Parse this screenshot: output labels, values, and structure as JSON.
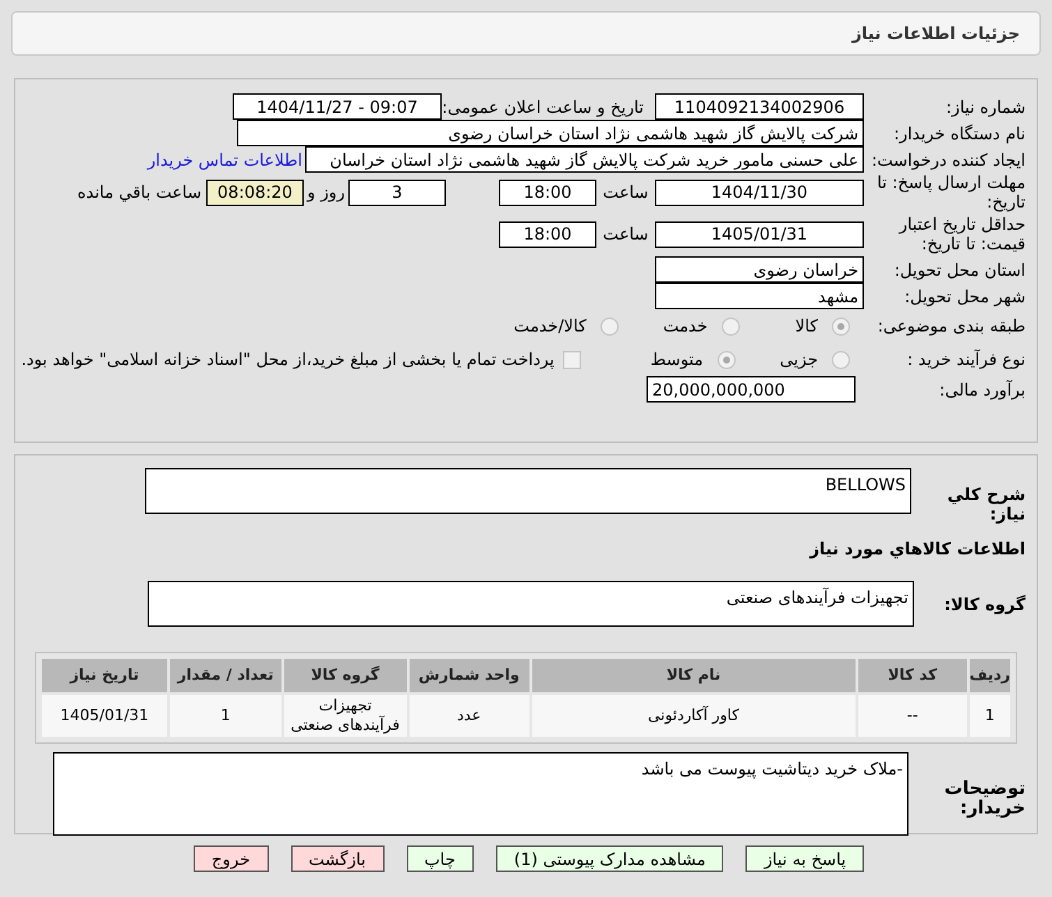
{
  "header": {
    "title": "جزئیات اطلاعات نیاز"
  },
  "need_number": {
    "label": "شماره نیاز:",
    "value": "1104092134002906"
  },
  "announce": {
    "label": "تاریخ و ساعت اعلان عمومی:",
    "value": "1404/11/27 - 09:07"
  },
  "buyer": {
    "label": "نام دستگاه خریدار:",
    "value": "شرکت پالایش گاز شهید هاشمی نژاد   استان خراسان رضوی"
  },
  "creator": {
    "label": "ایجاد کننده درخواست:",
    "value": "علی حسنی مامور خرید شرکت پالایش گاز شهید هاشمی نژاد   استان خراسان",
    "link": "اطلاعات تماس خریدار"
  },
  "deadline": {
    "label": "مهلت ارسال پاسخ: تا تاریخ:",
    "date": "1404/11/30",
    "time_label": "ساعت",
    "time": "18:00",
    "days": "3",
    "days_label": "روز و",
    "remaining": "08:08:20",
    "remaining_label": "ساعت باقي مانده"
  },
  "validity": {
    "label": "حداقل تاریخ اعتبار قیمت: تا تاریخ:",
    "date": "1405/01/31",
    "time_label": "ساعت",
    "time": "18:00"
  },
  "province": {
    "label": "استان محل تحویل:",
    "value": "خراسان رضوی"
  },
  "city": {
    "label": "شهر محل تحویل:",
    "value": "مشهد"
  },
  "category": {
    "label": "طبقه بندی موضوعی:",
    "options": [
      {
        "label": "كالا",
        "selected": true
      },
      {
        "label": "خدمت",
        "selected": false
      },
      {
        "label": "كالا/خدمت",
        "selected": false
      }
    ]
  },
  "process": {
    "label": "نوع فرآیند خرید :",
    "options": [
      {
        "label": "جزیی",
        "selected": false
      },
      {
        "label": "متوسط",
        "selected": true
      }
    ],
    "payment": {
      "checked": false,
      "label": "پرداخت تمام یا بخشی از مبلغ خرید،از محل \"اسناد خزانه اسلامی\" خواهد بود."
    }
  },
  "estimate": {
    "label": "برآورد مالی:",
    "value": "20,000,000,000"
  },
  "description": {
    "label": "شرح کلي نياز:",
    "value": "BELLOWS"
  },
  "goods_heading": "اطلاعات كالاهاي مورد نياز",
  "goods_group": {
    "label": "گروه کالا:",
    "value": "تجهیزات فرآیندهای صنعتی"
  },
  "table": {
    "columns": [
      "ردیف",
      "کد کالا",
      "نام کالا",
      "واحد شمارش",
      "گروه کالا",
      "تعداد / مقدار",
      "تاریخ نیاز"
    ],
    "rows": [
      [
        "1",
        "--",
        "کاور آکاردئونی",
        "عدد",
        "تجهیزات فرآیندهای صنعتی",
        "1",
        "1405/01/31"
      ]
    ]
  },
  "notes": {
    "label": "توضیحات خریدار:",
    "value": "-ملاک خرید دیتاشیت پیوست می باشد"
  },
  "buttons": [
    {
      "label": "پاسخ به نیاز",
      "kind": "normal"
    },
    {
      "label": "مشاهده مدارک پیوستی (1)",
      "kind": "normal"
    },
    {
      "label": "چاپ",
      "kind": "normal"
    },
    {
      "label": "بازگشت",
      "kind": "danger"
    },
    {
      "label": "خروج",
      "kind": "danger"
    }
  ]
}
